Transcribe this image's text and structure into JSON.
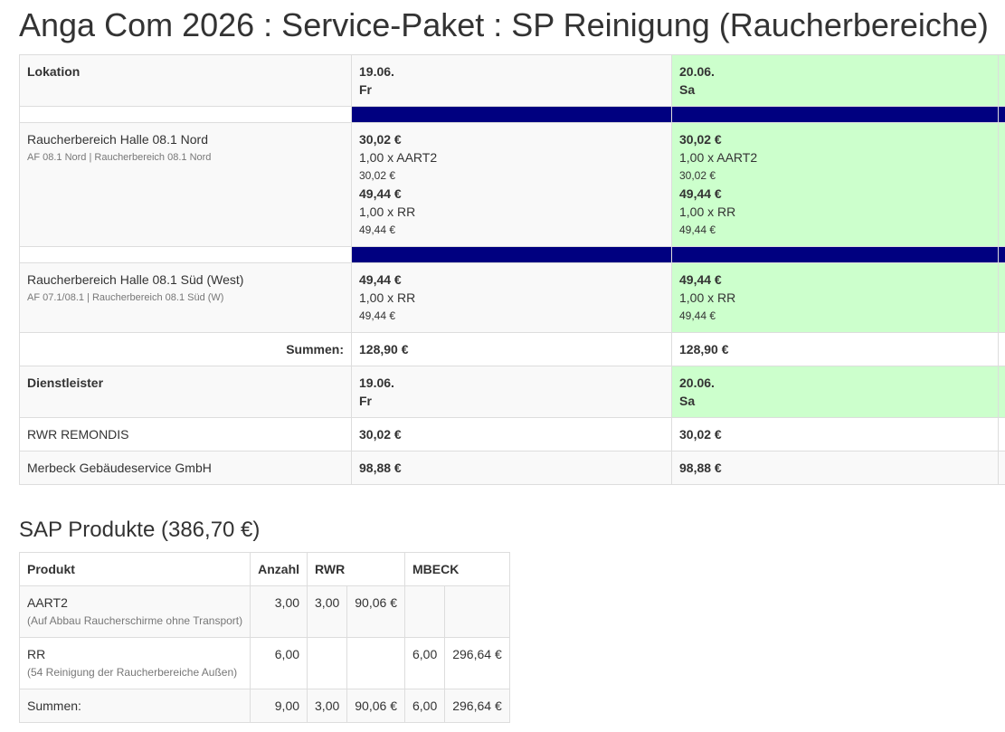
{
  "page_title": "Anga Com 2026 : Service-Paket : SP Reinigung (Raucherbereiche)",
  "main_table": {
    "location_header": "Lokation",
    "days": [
      {
        "date": "19.06.",
        "weekday": "Fr"
      },
      {
        "date": "20.06.",
        "weekday": "Sa"
      }
    ],
    "locations": [
      {
        "name": "Raucherbereich Halle 08.1 Nord",
        "sub": "AF 08.1 Nord | Raucherbereich 08.1 Nord",
        "day_items": [
          [
            {
              "total": "30,02 €",
              "qty": "1,00 x AART2",
              "price": "30,02 €"
            },
            {
              "total": "49,44 €",
              "qty": "1,00 x RR",
              "price": "49,44 €"
            }
          ],
          [
            {
              "total": "30,02 €",
              "qty": "1,00 x AART2",
              "price": "30,02 €"
            },
            {
              "total": "49,44 €",
              "qty": "1,00 x RR",
              "price": "49,44 €"
            }
          ]
        ]
      },
      {
        "name": "Raucherbereich Halle 08.1 Süd (West)",
        "sub": "AF 07.1/08.1 | Raucherbereich 08.1 Süd (W)",
        "day_items": [
          [
            {
              "total": "49,44 €",
              "qty": "1,00 x RR",
              "price": "49,44 €"
            }
          ],
          [
            {
              "total": "49,44 €",
              "qty": "1,00 x RR",
              "price": "49,44 €"
            }
          ]
        ]
      }
    ],
    "sums_label": "Summen:",
    "sums": [
      "128,90 €",
      "128,90 €"
    ],
    "provider_header": "Dienstleister",
    "providers": [
      {
        "name": "RWR REMONDIS",
        "values": [
          "30,02 €",
          "30,02 €"
        ]
      },
      {
        "name": "Merbeck Gebäudeservice GmbH",
        "values": [
          "98,88 €",
          "98,88 €"
        ]
      }
    ]
  },
  "sap": {
    "title": "SAP Produkte (386,70 €)",
    "headers": {
      "product": "Produkt",
      "count": "Anzahl",
      "rwr": "RWR",
      "mbeck": "MBECK"
    },
    "rows": [
      {
        "product": "AART2",
        "desc": "(Auf Abbau Raucherschirme ohne Transport)",
        "count": "3,00",
        "rwr_qty": "3,00",
        "rwr_sum": "90,06 €",
        "mbeck_qty": "",
        "mbeck_sum": ""
      },
      {
        "product": "RR",
        "desc": "(54 Reinigung der Raucherbereiche Außen)",
        "count": "6,00",
        "rwr_qty": "",
        "rwr_sum": "",
        "mbeck_qty": "6,00",
        "mbeck_sum": "296,64 €"
      }
    ],
    "sums": {
      "label": "Summen:",
      "count": "9,00",
      "rwr_qty": "3,00",
      "rwr_sum": "90,06 €",
      "mbeck_qty": "6,00",
      "mbeck_sum": "296,64 €"
    }
  },
  "colors": {
    "spacer_bar": "#000080",
    "saturday_bg": "#ccffcc",
    "stripe_bg": "#f9f9f9"
  }
}
